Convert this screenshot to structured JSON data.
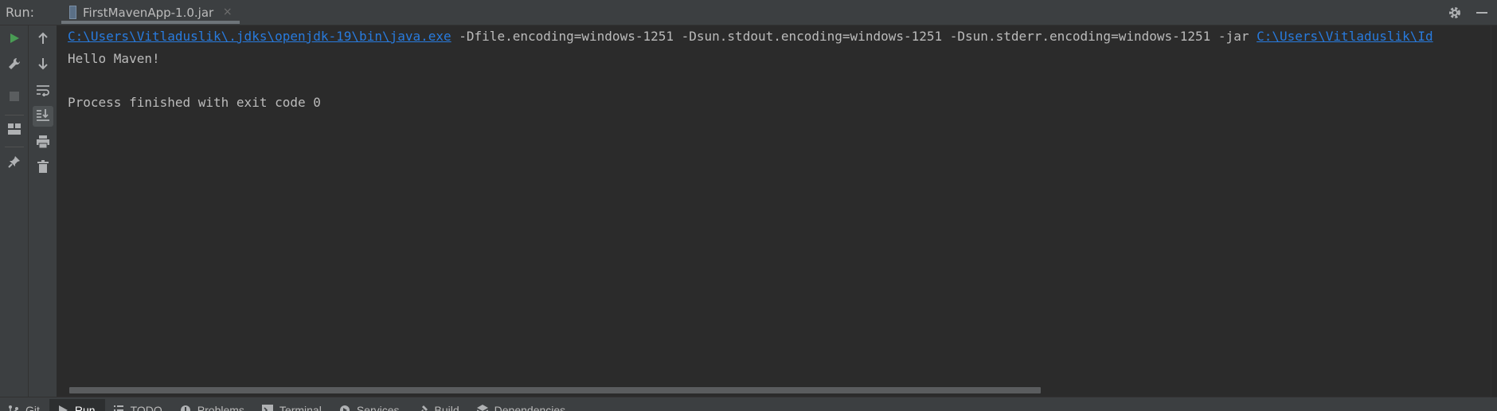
{
  "run_header": {
    "label": "Run:",
    "tab": {
      "label": "FirstMavenApp-1.0.jar",
      "icon": "jar-file-icon",
      "close": "×"
    },
    "actions": [
      "gear-icon",
      "minimize-icon"
    ]
  },
  "left_toolbar": [
    "rerun-icon",
    "wrench-icon",
    "stop-icon",
    "layout-icon",
    "pin-icon"
  ],
  "console_toolbar": [
    "up-arrow-icon",
    "down-arrow-icon",
    "soft-wrap-icon",
    "scroll-to-end-icon",
    "print-icon",
    "trash-icon"
  ],
  "console": {
    "line1": {
      "java_path": "C:\\Users\\Vitladuslik\\.jdks\\openjdk-19\\bin\\java.exe",
      "args": " -Dfile.encoding=windows-1251 -Dsun.stdout.encoding=windows-1251 -Dsun.stderr.encoding=windows-1251 -jar ",
      "jar_path": "C:\\Users\\Vitladuslik\\Id"
    },
    "line2": "Hello Maven!",
    "line4": "Process finished with exit code 0"
  },
  "bottom_bar": {
    "items": [
      {
        "label": "Git",
        "icon": "git-icon"
      },
      {
        "label": "Run",
        "icon": "run-icon",
        "active": true
      },
      {
        "label": "TODO",
        "icon": "todo-icon"
      },
      {
        "label": "Problems",
        "icon": "problems-icon"
      },
      {
        "label": "Terminal",
        "icon": "terminal-icon"
      },
      {
        "label": "Services",
        "icon": "services-icon"
      },
      {
        "label": "Build",
        "icon": "build-icon"
      },
      {
        "label": "Dependencies",
        "icon": "dependencies-icon"
      }
    ]
  },
  "colors": {
    "accent_link": "#287bde",
    "run_green": "#499c54",
    "background": "#2b2b2b",
    "panel": "#3c3f41"
  }
}
